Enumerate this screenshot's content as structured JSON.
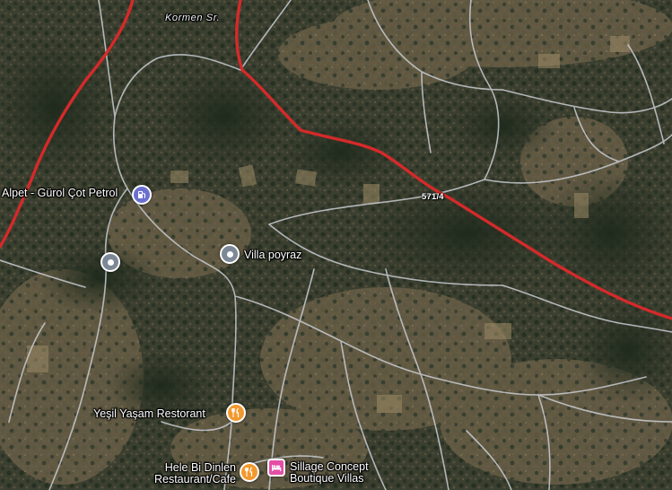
{
  "map": {
    "view": "satellite",
    "colors": {
      "primary_road": "#d42a2a",
      "minor_road": "#c9ccd2",
      "gas_pin": "#6a6fd0",
      "place_pin": "#7d8896",
      "food_pin": "#f2992e",
      "lodging_pin": "#e44fa6"
    },
    "labels": {
      "street": "Kormen Sr.",
      "route": "571/4"
    },
    "places": [
      {
        "name": "Alpet - Gürol Çot Petrol",
        "category": "gas-station",
        "icon": "fuel-pump-icon"
      },
      {
        "name": "",
        "category": "place",
        "icon": "location-pin-icon"
      },
      {
        "name": "Villa poyraz",
        "category": "place",
        "icon": "location-pin-icon"
      },
      {
        "name": "Yeşil Yaşam Restorant",
        "category": "restaurant",
        "icon": "fork-knife-icon"
      },
      {
        "name_line1": "Hele Bi Dinlen",
        "name_line2": "Restaurant/Cafe",
        "category": "restaurant",
        "icon": "fork-knife-icon"
      },
      {
        "name_line1": "Sillage Concept",
        "name_line2": "Boutique Villas",
        "category": "lodging",
        "icon": "bed-icon"
      }
    ]
  }
}
